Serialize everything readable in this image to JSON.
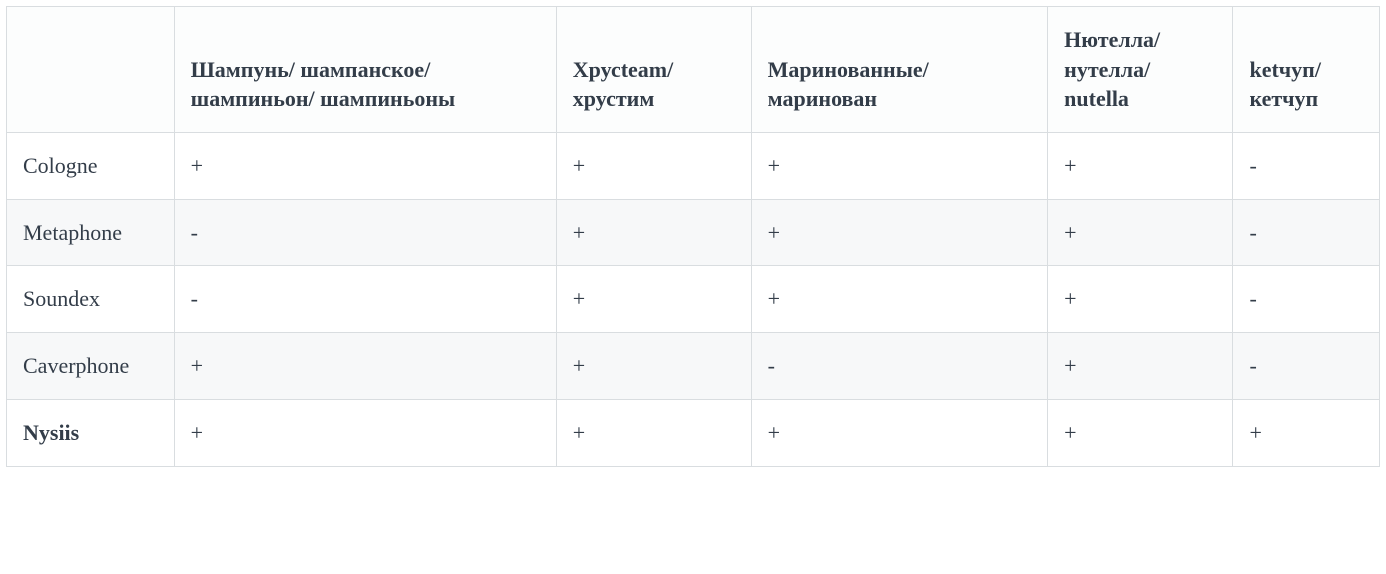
{
  "chart_data": {
    "type": "table",
    "columns": [
      "",
      "Шампунь/ шампанское/ шампиньон/ шампиньоны",
      "Хрусteam/ хрустим",
      "Маринованные/ маринован",
      "Нютелла/ нутелла/ nutella",
      "ketчуп/ кетчуп"
    ],
    "rows": [
      {
        "label": "Cologne",
        "cells": [
          "+",
          "+",
          "+",
          "+",
          "-"
        ],
        "emphasis": false
      },
      {
        "label": "Metaphone",
        "cells": [
          "-",
          "+",
          "+",
          "+",
          "-"
        ],
        "emphasis": false
      },
      {
        "label": "Soundex",
        "cells": [
          "-",
          "+",
          "+",
          "+",
          "-"
        ],
        "emphasis": false
      },
      {
        "label": "Caverphone",
        "cells": [
          "+",
          "+",
          "-",
          "+",
          "-"
        ],
        "emphasis": false
      },
      {
        "label": "Nysiis",
        "cells": [
          "+",
          "+",
          "+",
          "+",
          "+"
        ],
        "emphasis": true
      }
    ]
  }
}
